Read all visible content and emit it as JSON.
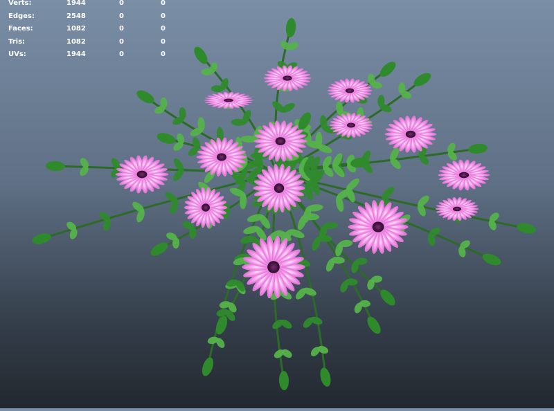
{
  "heads_up_display": {
    "rows": [
      {
        "label": "Verts:",
        "values": [
          "1944",
          "0",
          "0"
        ]
      },
      {
        "label": "Edges:",
        "values": [
          "2548",
          "0",
          "0"
        ]
      },
      {
        "label": "Faces:",
        "values": [
          "1082",
          "0",
          "0"
        ]
      },
      {
        "label": "Tris:",
        "values": [
          "1082",
          "0",
          "0"
        ]
      },
      {
        "label": "UVs:",
        "values": [
          "1944",
          "0",
          "0"
        ]
      }
    ]
  },
  "viewport": {
    "background_top": "#7a8ea6",
    "background_bottom": "#23282f",
    "flower_color": "#f07ee0",
    "flower_center_color": "#4a1640",
    "leaf_color": "#2f8a2c",
    "leaf_highlight": "#55b24a"
  }
}
